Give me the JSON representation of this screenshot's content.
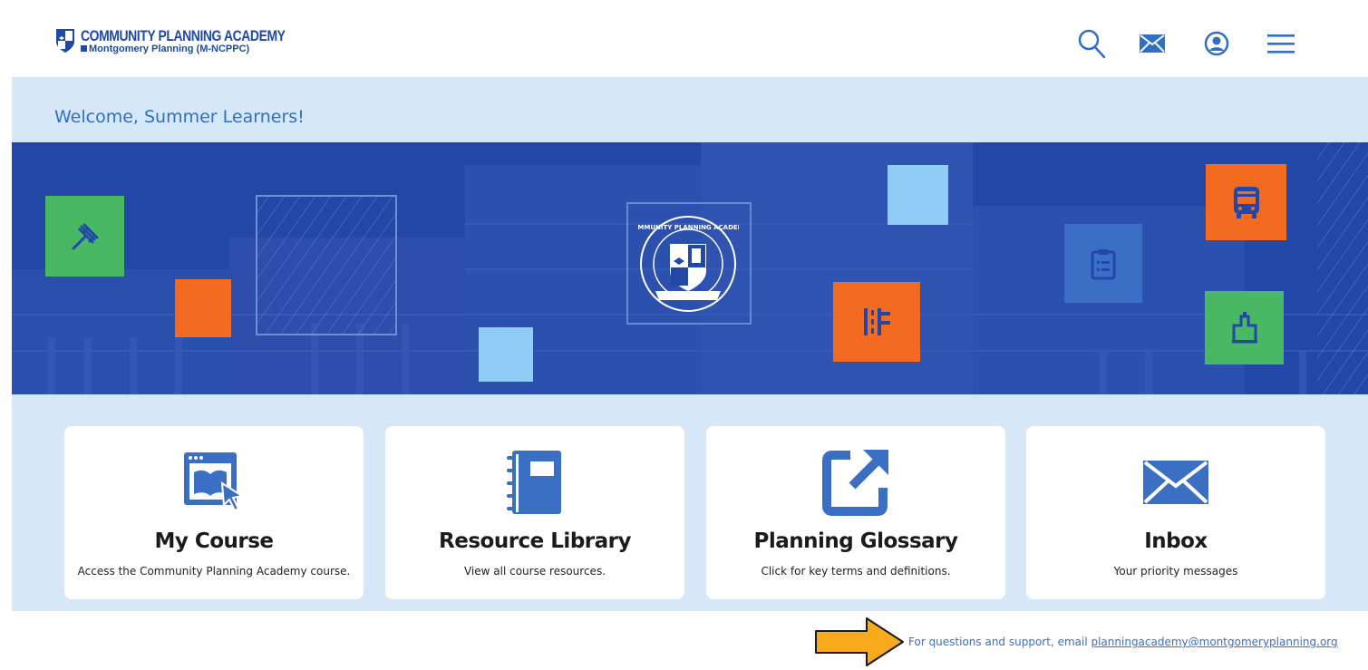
{
  "header": {
    "logo_title": "COMMUNITY PLANNING ACADEMY",
    "logo_subtitle": "Montgomery Planning  (M-NCPPC)",
    "icons": [
      "search-icon",
      "mail-icon",
      "account-icon",
      "menu-icon"
    ]
  },
  "welcome": "Welcome, Summer Learners!",
  "hero": {
    "seal_text": "COMMUNITY PLANNING ACADEMY",
    "tile_icons": [
      "gavel-icon",
      "clipboard-icon",
      "road-sign-icon",
      "bus-icon",
      "building-icon"
    ]
  },
  "cards": [
    {
      "title": "My Course",
      "desc": "Access the Community Planning Academy course.",
      "icon": "course-icon"
    },
    {
      "title": "Resource Library",
      "desc": "View all course resources.",
      "icon": "notebook-icon"
    },
    {
      "title": "Planning Glossary",
      "desc": "Click for key terms and definitions.",
      "icon": "external-link-icon"
    },
    {
      "title": "Inbox",
      "desc": "Your priority messages",
      "icon": "envelope-icon"
    }
  ],
  "support": {
    "text": "For questions and support, email ",
    "email": "planningacademy@montgomeryplanning.org"
  },
  "colors": {
    "brand_blue": "#2347a6",
    "accent_blue": "#3a6fc4",
    "orange": "#f26b21",
    "green": "#48b865",
    "light_blue": "#8fcdf7",
    "band": "#d6e8f7",
    "arrow": "#f9a91c"
  }
}
